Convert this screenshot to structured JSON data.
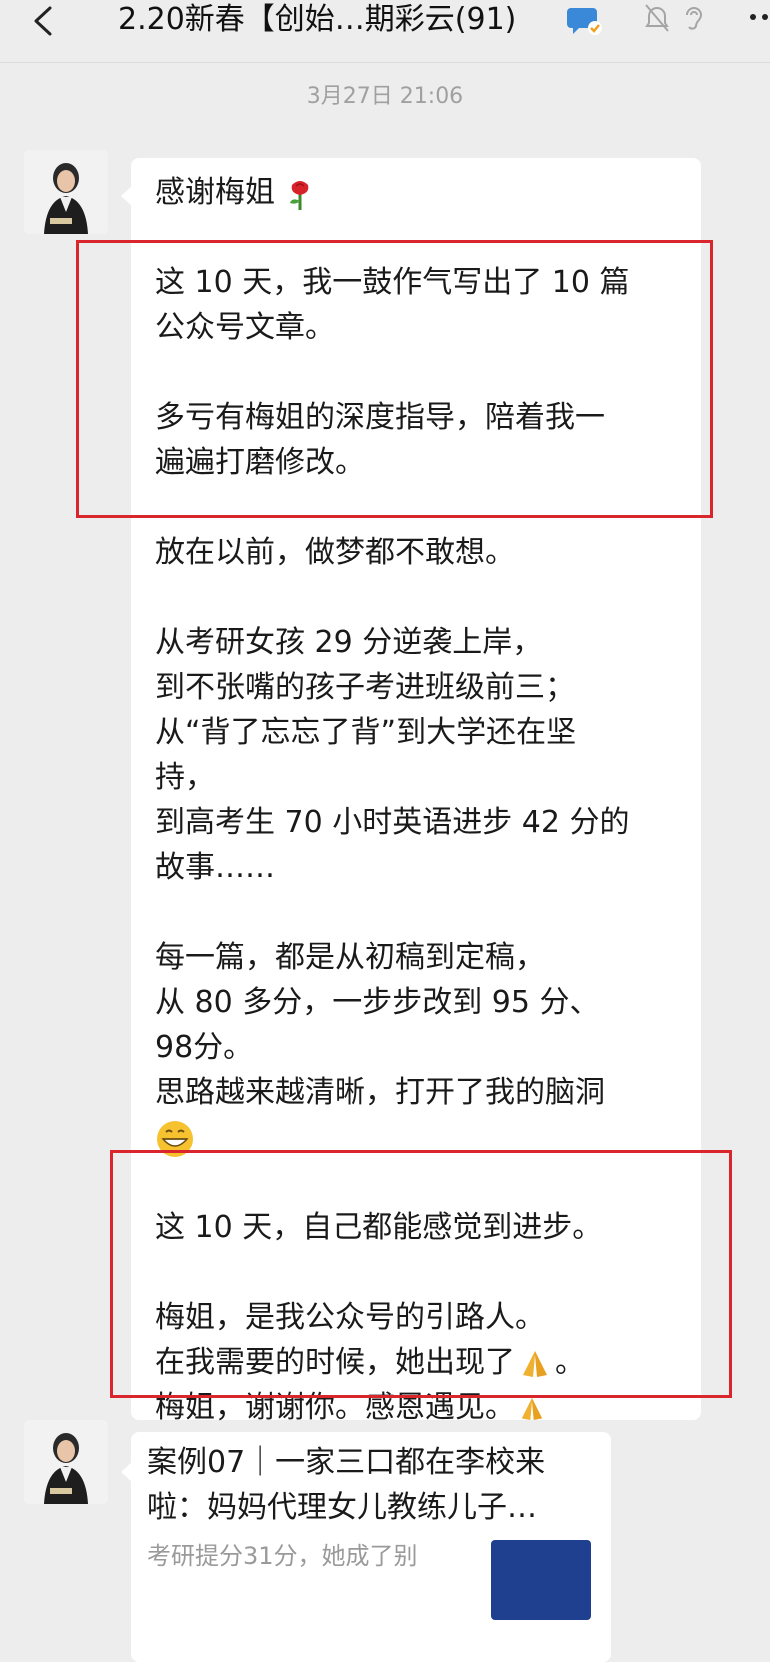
{
  "header": {
    "title": "2.20新春【创始…期彩云(91)",
    "icons": [
      "back-icon",
      "group-badge-icon",
      "mute-bell-icon",
      "ear-icon",
      "more-icon"
    ]
  },
  "timestamp": "3月27日 21:06",
  "message": {
    "paragraphs": [
      "感谢梅姐",
      "这 10 天，我一鼓作气写出了 10 篇\n公众号文章。",
      "多亏有梅姐的深度指导，陪着我一\n遍遍打磨修改。",
      "放在以前，做梦都不敢想。",
      "从考研女孩 29 分逆袭上岸，\n到不张嘴的孩子考进班级前三；\n从“背了忘忘了背”到大学还在坚\n持，\n到高考生 70 小时英语进步 42 分的\n故事……",
      "每一篇，都是从初稿到定稿，\n从 80 多分，一步步改到 95 分、\n98分。\n思路越来越清晰，打开了我的脑洞",
      "这 10 天，自己都能感觉到进步。",
      "梅姐，是我公众号的引路人。\n在我需要的时候，她出现了",
      "梅姐，谢谢你。感恩遇见。"
    ],
    "emojis": [
      "rose-emoji",
      "grin-emoji",
      "pray-emoji",
      "pray-emoji"
    ]
  },
  "card": {
    "title": "案例07｜一家三口都在李校来啦：妈妈代理女儿教练儿子…",
    "description": "考研提分31分，她成了别"
  },
  "colors": {
    "background": "#ededed",
    "bubble": "#ffffff",
    "highlight": "#d8262c",
    "thumb": "#1f3f8f"
  }
}
